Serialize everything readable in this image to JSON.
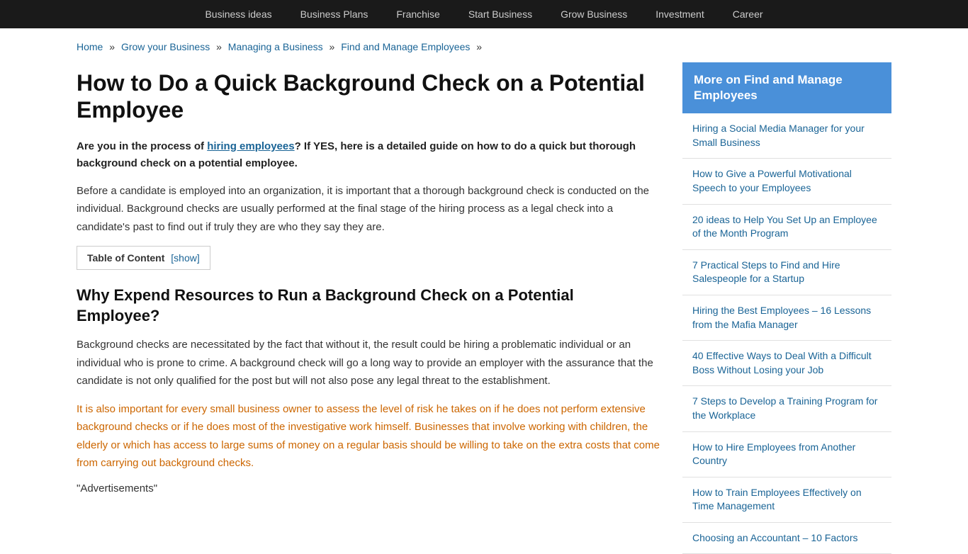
{
  "nav": {
    "items": [
      {
        "label": "Business ideas",
        "href": "#"
      },
      {
        "label": "Business Plans",
        "href": "#"
      },
      {
        "label": "Franchise",
        "href": "#"
      },
      {
        "label": "Start Business",
        "href": "#"
      },
      {
        "label": "Grow Business",
        "href": "#"
      },
      {
        "label": "Investment",
        "href": "#"
      },
      {
        "label": "Career",
        "href": "#"
      }
    ]
  },
  "breadcrumb": {
    "items": [
      {
        "label": "Home",
        "href": "#"
      },
      {
        "label": "Grow your Business",
        "href": "#"
      },
      {
        "label": "Managing a Business",
        "href": "#"
      },
      {
        "label": "Find and Manage Employees",
        "href": "#"
      }
    ],
    "separator": "»"
  },
  "article": {
    "title": "How to Do a Quick Background Check on a Potential Employee",
    "intro_bold": "Are you in the process of ",
    "intro_link_text": "hiring employees",
    "intro_rest": "? If YES, here is a detailed guide on how to do a quick but thorough background check on a potential employee.",
    "paragraph1": "Before a candidate is employed into an organization, it is important that a thorough background check is conducted on the individual. Background checks are usually performed at the final stage of the hiring process as a  legal check into a candidate's past to find out if truly they are who they say they are.",
    "toc_label": "Table of Content",
    "toc_show": "[show]",
    "section_heading": "Why Expend Resources to Run a Background Check on a Potential Employee?",
    "paragraph2": "Background checks are necessitated by the fact that without it, the result could be hiring a problematic individual or an individual who is prone to crime. A background check will go a long way to provide an employer with the assurance that the candidate is not only qualified for the post but will not also pose any legal threat to the establishment.",
    "paragraph3": "It is also important for every small business owner to assess the level of risk he takes on if he does not perform extensive background checks or if he does most of the investigative work himself. Businesses that involve working with children, the elderly or which has access to large sums of money on a regular basis should be willing to take on the extra costs that come from carrying out background checks.",
    "ads_text": "\"Advertisements\""
  },
  "sidebar": {
    "header": "More on Find and Manage Employees",
    "links": [
      {
        "label": "Hiring a Social Media Manager for your Small Business"
      },
      {
        "label": "How to Give a Powerful Motivational Speech to your Employees"
      },
      {
        "label": "20 ideas to Help You Set Up an Employee of the Month Program"
      },
      {
        "label": "7 Practical Steps to Find and Hire Salespeople for a Startup"
      },
      {
        "label": "Hiring the Best Employees – 16 Lessons from the Mafia Manager"
      },
      {
        "label": "40 Effective Ways to Deal With a Difficult Boss Without Losing your Job"
      },
      {
        "label": "7 Steps to Develop a Training Program for the Workplace"
      },
      {
        "label": "How to Hire Employees from Another Country"
      },
      {
        "label": "How to Train Employees Effectively on Time Management"
      },
      {
        "label": "Choosing an Accountant – 10 Factors"
      }
    ]
  }
}
